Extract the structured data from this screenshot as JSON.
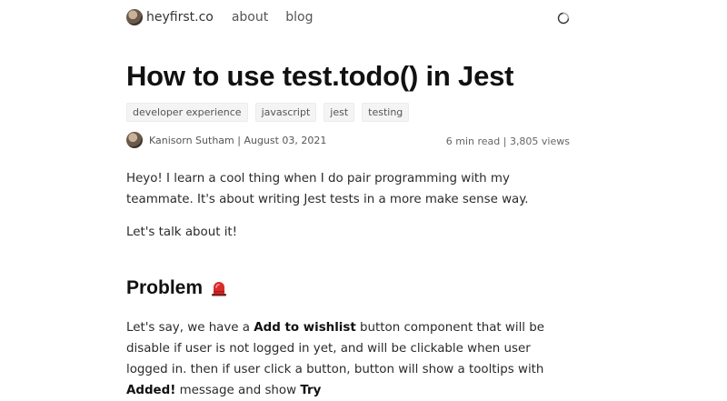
{
  "nav": {
    "brand": "heyfirst.co",
    "links": [
      "about",
      "blog"
    ]
  },
  "post": {
    "title": "How to use test.todo() in Jest",
    "tags": [
      "developer experience",
      "javascript",
      "jest",
      "testing"
    ],
    "author_date": "Kanisorn Sutham | August 03, 2021",
    "stats": "6 min read | 3,805 views",
    "paragraph1": "Heyo! I learn a cool thing when I do pair programming with my teammate. It's about writing Jest tests in a more make sense way.",
    "paragraph2": "Let's talk about it!",
    "heading_problem": "Problem",
    "p4": {
      "t1": "Let's say, we have a ",
      "b1": "Add to wishlist",
      "t2": " button component that will be disable if user is not logged in yet, and will be clickable when user logged in. then if user click a button, button will show a tooltips with ",
      "b2": "Added!",
      "t3": " message and show ",
      "b3": "Try"
    }
  },
  "icons": {
    "brand_avatar": "avatar-photo",
    "theme_toggle": "theme-toggle-icon",
    "siren": "siren-emoji"
  }
}
